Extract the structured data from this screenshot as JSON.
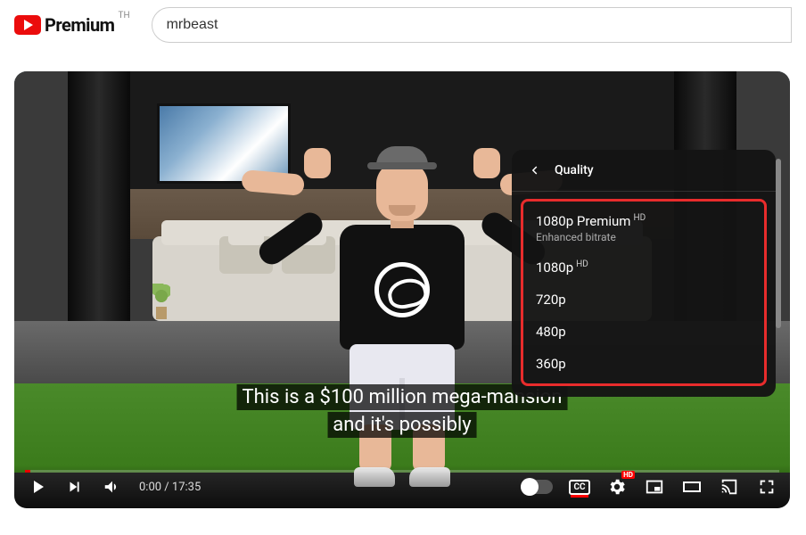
{
  "header": {
    "brand": "Premium",
    "region": "TH",
    "search_value": "mrbeast"
  },
  "captions": {
    "line1": "This is a $100 million mega-mansion",
    "line2": "and it's possibly"
  },
  "quality_menu": {
    "title": "Quality",
    "items": [
      {
        "label": "1080p Premium",
        "badge": "HD",
        "sub": "Enhanced bitrate"
      },
      {
        "label": "1080p",
        "badge": "HD",
        "sub": ""
      },
      {
        "label": "720p",
        "badge": "",
        "sub": ""
      },
      {
        "label": "480p",
        "badge": "",
        "sub": ""
      },
      {
        "label": "360p",
        "badge": "",
        "sub": ""
      }
    ]
  },
  "controls": {
    "current_time": "0:00",
    "separator": " / ",
    "duration": "17:35",
    "cc_label": "CC",
    "hd_badge": "HD"
  }
}
